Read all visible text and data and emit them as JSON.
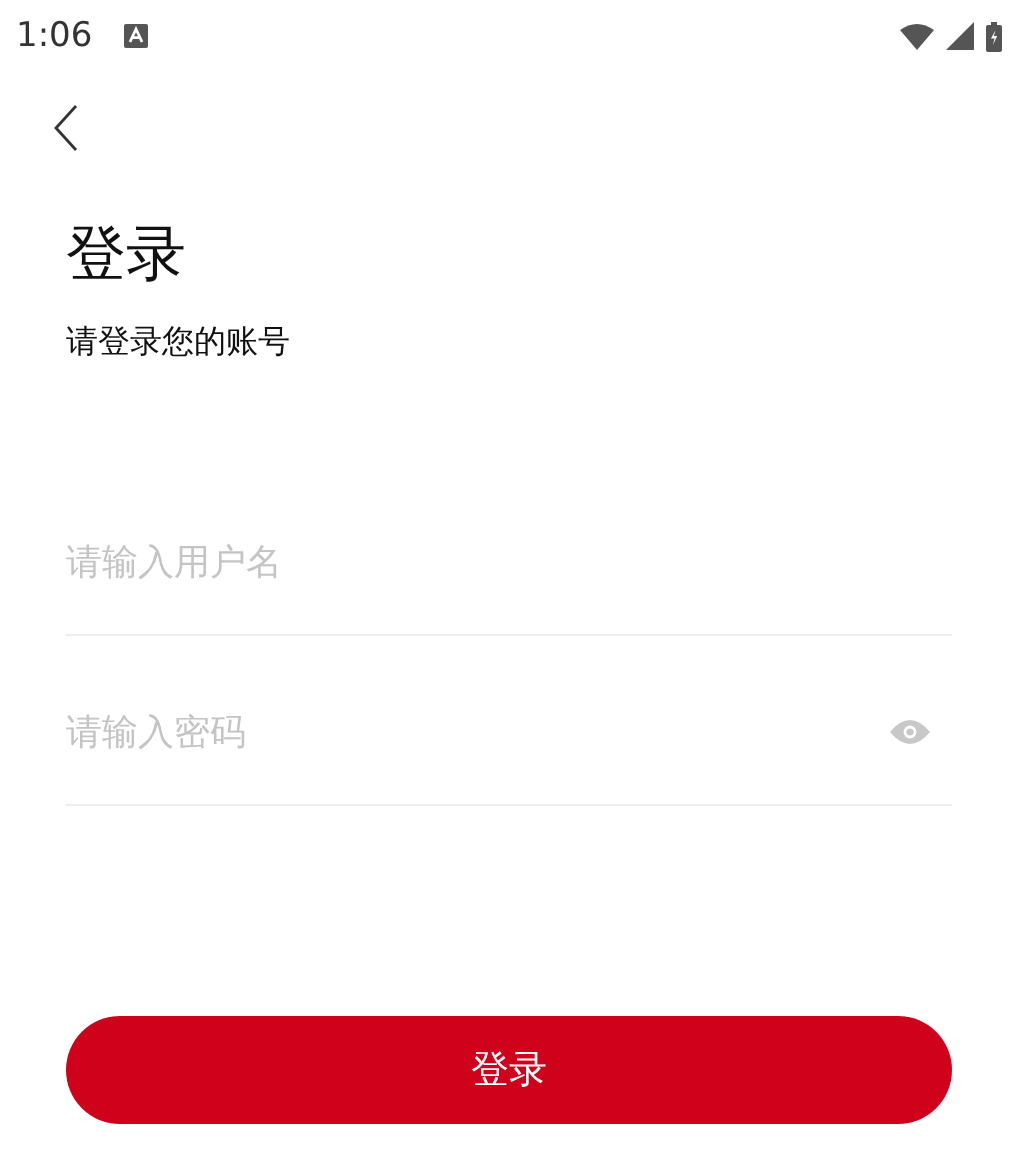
{
  "status_bar": {
    "time": "1:06"
  },
  "title": "登录",
  "subtitle": "请登录您的账号",
  "fields": [
    {
      "kind": "text",
      "placeholder": "请输入用户名"
    },
    {
      "kind": "password",
      "placeholder": "请输入密码"
    }
  ],
  "login_button": "登录"
}
